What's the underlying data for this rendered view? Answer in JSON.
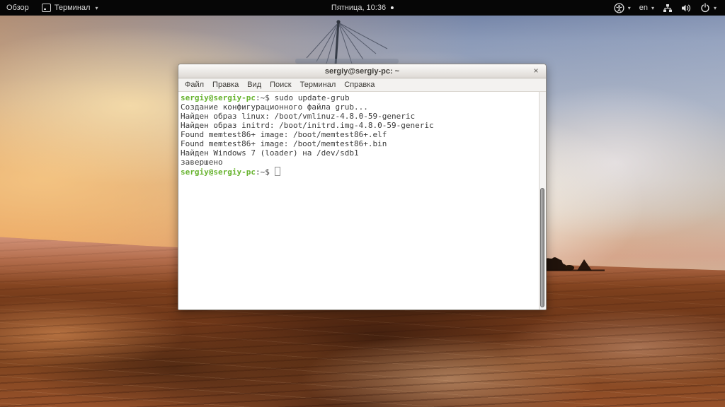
{
  "top_bar": {
    "activities_label": "Обзор",
    "focused_app_label": "Терминал",
    "clock_label": "Пятница, 10:36",
    "keyboard_layout_label": "en",
    "caret_glyph": "▾",
    "icons": [
      "terminal-app-icon",
      "accessibility-icon",
      "keyboard-layout",
      "wired-network-icon",
      "volume-icon",
      "power-icon"
    ],
    "background_color": "#060606",
    "text_color": "#dadada"
  },
  "window": {
    "title": "sergiy@sergiy-pc: ~",
    "close_label": "×",
    "menu_items": [
      "Файл",
      "Правка",
      "Вид",
      "Поиск",
      "Терминал",
      "Справка"
    ],
    "terminal": {
      "prompt_user_host": "sergiy@sergiy-pc",
      "prompt_tail": ":~$",
      "command": "sudo update-grub",
      "output_lines": [
        "Создание конфигурационного файла grub...",
        "Найден образ linux: /boot/vmlinuz-4.8.0-59-generic",
        "Найден образ initrd: /boot/initrd.img-4.8.0-59-generic",
        "Found memtest86+ image: /boot/memtest86+.elf",
        "Found memtest86+ image: /boot/memtest86+.bin",
        "Найден Windows 7 (loader) на /dev/sdb1",
        "завершено"
      ],
      "colors": {
        "prompt_green": "#67b32e",
        "text": "#3a3a3a",
        "background": "#ffffff"
      }
    }
  }
}
